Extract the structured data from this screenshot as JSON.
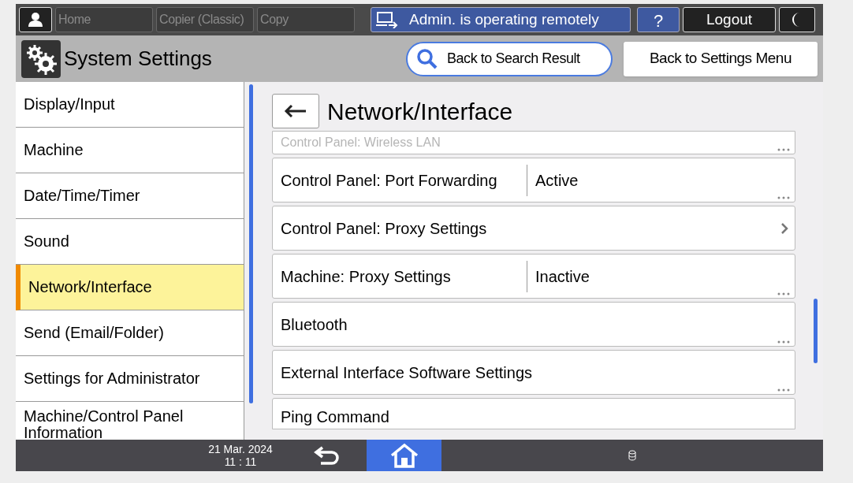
{
  "top_bar": {
    "tabs": [
      {
        "label": "Home"
      },
      {
        "label": "Copier (Classic)"
      },
      {
        "label": "Copy"
      }
    ],
    "remote_notice": "Admin. is operating remotely",
    "help": "?",
    "logout": "Logout"
  },
  "header": {
    "title": "System Settings",
    "search_button": "Back to Search Result",
    "menu_button": "Back to Settings Menu"
  },
  "sidebar": {
    "items": [
      {
        "label": "Display/Input",
        "selected": false
      },
      {
        "label": "Machine",
        "selected": false
      },
      {
        "label": "Date/Time/Timer",
        "selected": false
      },
      {
        "label": "Sound",
        "selected": false
      },
      {
        "label": "Network/Interface",
        "selected": true
      },
      {
        "label": "Send (Email/Folder)",
        "selected": false
      },
      {
        "label": "Settings for Administrator",
        "selected": false
      },
      {
        "label": "Machine/Control Panel Information",
        "selected": false
      }
    ]
  },
  "content": {
    "title": "Network/Interface",
    "settings": [
      {
        "kind": "faded",
        "label": "Control Panel: Wireless LAN"
      },
      {
        "kind": "value",
        "label": "Control Panel: Port Forwarding",
        "value": "Active"
      },
      {
        "kind": "link",
        "label": "Control Panel: Proxy Settings"
      },
      {
        "kind": "value",
        "label": "Machine: Proxy Settings",
        "value": "Inactive"
      },
      {
        "kind": "plain",
        "label": "Bluetooth"
      },
      {
        "kind": "plain",
        "label": "External Interface Software Settings"
      },
      {
        "kind": "cut",
        "label": "Ping Command"
      }
    ]
  },
  "status_bar": {
    "date": "21 Mar. 2024",
    "time": "11 : 11"
  }
}
